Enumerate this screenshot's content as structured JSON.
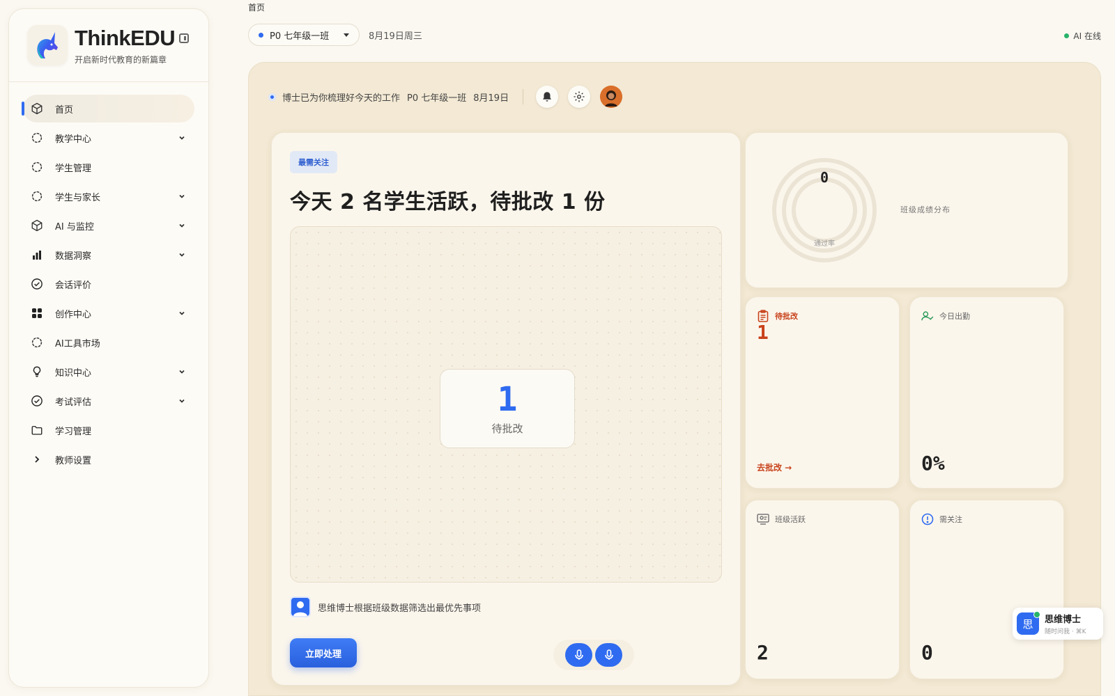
{
  "brand": {
    "name": "ThinkEDU",
    "subtitle": "开启新时代教育的新篇章"
  },
  "sidebar": {
    "items": [
      {
        "label": "首页",
        "icon": "cube-icon",
        "active": true,
        "expandable": false
      },
      {
        "label": "教学中心",
        "icon": "dots-circle-icon",
        "expandable": true
      },
      {
        "label": "学生管理",
        "icon": "dots-circle-icon",
        "expandable": false
      },
      {
        "label": "学生与家长",
        "icon": "dots-circle-icon",
        "expandable": true
      },
      {
        "label": "AI 与监控",
        "icon": "cube-icon",
        "expandable": true
      },
      {
        "label": "数据洞察",
        "icon": "bar-chart-icon",
        "expandable": true
      },
      {
        "label": "会话评价",
        "icon": "check-circle-icon",
        "expandable": false
      },
      {
        "label": "创作中心",
        "icon": "grid-icon",
        "expandable": true
      },
      {
        "label": "AI工具市场",
        "icon": "dots-circle-icon",
        "expandable": false
      },
      {
        "label": "知识中心",
        "icon": "lightbulb-icon",
        "expandable": true
      },
      {
        "label": "考试评估",
        "icon": "check-circle-icon",
        "expandable": true
      },
      {
        "label": "学习管理",
        "icon": "folder-icon",
        "expandable": false
      },
      {
        "label": "教师设置",
        "icon": "chevron-right-icon",
        "expandable": false
      }
    ]
  },
  "topbar": {
    "breadcrumb": "首页",
    "class_select": "P0 七年级一班",
    "date": "8月19日周三",
    "ai_status": "AI 在线"
  },
  "headline": {
    "message": "博士已为你梳理好今天的工作",
    "class": "P0 七年级一班",
    "date": "8月19日"
  },
  "focus": {
    "tag": "最需关注",
    "title": "今天 2 名学生活跃，待批改 1 份",
    "stat_value": "1",
    "stat_label": "待批改",
    "doctor_note": "思维博士根据班级数据筛选出最优先事项",
    "action_label": "立即处理"
  },
  "score": {
    "value": "0",
    "label": "通过率",
    "title": "班级成绩分布",
    "pass_rate": 0
  },
  "cards": {
    "pending": {
      "title": "待批改",
      "value": "1",
      "link": "去批改 →"
    },
    "attendance": {
      "title": "今日出勤",
      "value": "0%"
    },
    "activity": {
      "title": "班级活跃",
      "value": "2"
    },
    "concern": {
      "title": "需关注",
      "value": "0"
    }
  },
  "assistant": {
    "icon_char": "思",
    "name": "思维博士",
    "sub": "随时问我 · ⌘K"
  },
  "colors": {
    "accent": "#2f6bf0",
    "alert": "#c8421b",
    "online": "#27b36a",
    "panel": "#f3e9d4"
  }
}
